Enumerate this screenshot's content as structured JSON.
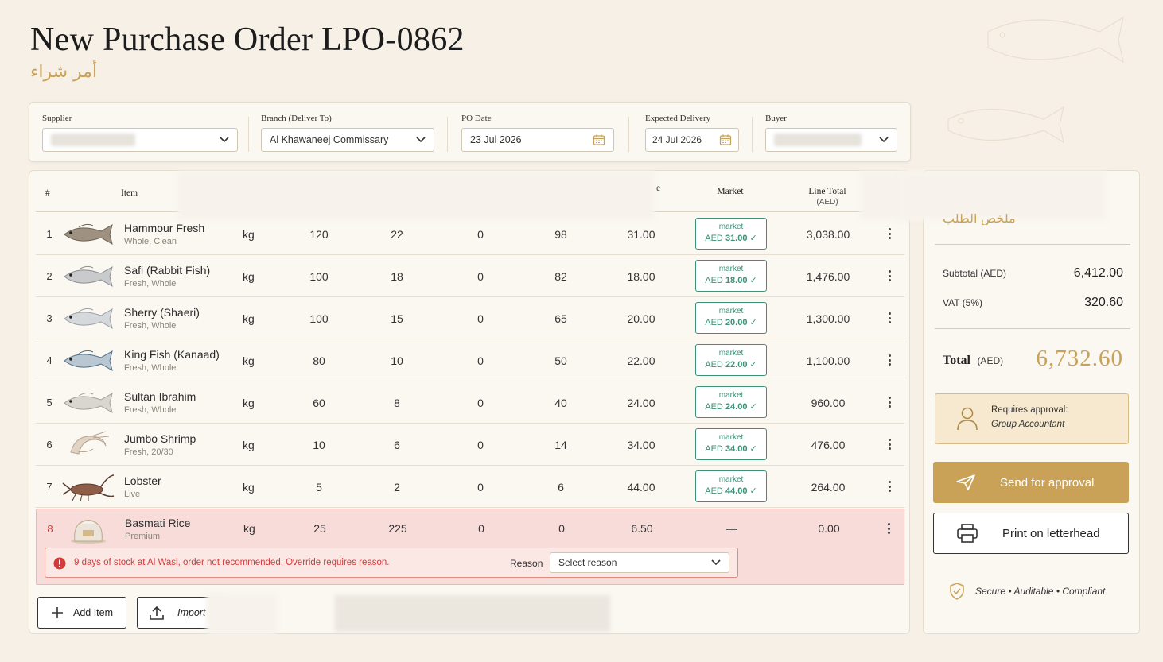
{
  "page": {
    "title": "New Purchase Order LPO-0862",
    "subtitle_ar": "أمر شراء"
  },
  "header": {
    "supplier_label": "Supplier",
    "branch_label": "Branch (Deliver To)",
    "branch_value": "Al Khawaneej Commissary",
    "po_date_label": "PO Date",
    "po_date_value": "23 Jul 2026",
    "expected_label": "Expected Delivery",
    "expected_value": "24 Jul 2026",
    "buyer_label": "Buyer"
  },
  "table": {
    "headers": {
      "hash": "#",
      "item": "Item",
      "partial": "e",
      "market": "Market",
      "line_total": "Line Total",
      "line_total_unit": "(AED)"
    },
    "rows": [
      {
        "n": "1",
        "name": "Hammour Fresh",
        "sub": "Whole, Clean",
        "unit": "kg",
        "c1": "120",
        "c2": "22",
        "c3": "0",
        "c4": "98",
        "price": "31.00",
        "m1": "market",
        "m2": "AED ",
        "m2b": "31.00",
        "check": "✓",
        "total": "3,038.00"
      },
      {
        "n": "2",
        "name": "Safi (Rabbit Fish)",
        "sub": "Fresh, Whole",
        "unit": "kg",
        "c1": "100",
        "c2": "18",
        "c3": "0",
        "c4": "82",
        "price": "18.00",
        "m1": "market",
        "m2": "AED ",
        "m2b": "18.00",
        "check": "✓",
        "total": "1,476.00"
      },
      {
        "n": "3",
        "name": "Sherry (Shaeri)",
        "sub": "Fresh, Whole",
        "unit": "kg",
        "c1": "100",
        "c2": "15",
        "c3": "0",
        "c4": "65",
        "price": "20.00",
        "m1": "market",
        "m2": "AED ",
        "m2b": "20.00",
        "check": "✓",
        "total": "1,300.00"
      },
      {
        "n": "4",
        "name": "King Fish (Kanaad)",
        "sub": "Fresh, Whole",
        "unit": "kg",
        "c1": "80",
        "c2": "10",
        "c3": "0",
        "c4": "50",
        "price": "22.00",
        "m1": "market",
        "m2": "AED ",
        "m2b": "22.00",
        "check": "✓",
        "total": "1,100.00"
      },
      {
        "n": "5",
        "name": "Sultan Ibrahim",
        "sub": "Fresh, Whole",
        "unit": "kg",
        "c1": "60",
        "c2": "8",
        "c3": "0",
        "c4": "40",
        "price": "24.00",
        "m1": "market",
        "m2": "AED ",
        "m2b": "24.00",
        "check": "✓",
        "total": "960.00"
      },
      {
        "n": "6",
        "name": "Jumbo Shrimp",
        "sub": "Fresh, 20/30",
        "unit": "kg",
        "c1": "10",
        "c2": "6",
        "c3": "0",
        "c4": "14",
        "price": "34.00",
        "m1": "market",
        "m2": "AED ",
        "m2b": "34.00",
        "check": "✓",
        "total": "476.00"
      },
      {
        "n": "7",
        "name": "Lobster",
        "sub": "Live",
        "unit": "kg",
        "c1": "5",
        "c2": "2",
        "c3": "0",
        "c4": "6",
        "price": "44.00",
        "m1": "market",
        "m2": "AED ",
        "m2b": "44.00",
        "check": "✓",
        "total": "264.00"
      }
    ],
    "warn_row": {
      "n": "8",
      "name": "Basmati Rice",
      "sub": "Premium",
      "unit": "kg",
      "c1": "25",
      "c2": "225",
      "c3": "0",
      "c4": "0",
      "price": "6.50",
      "market": "—",
      "total": "0.00"
    },
    "warning": {
      "message": "9 days of stock at Al Wasl, order not recommended. Override requires reason.",
      "reason_label": "Reason",
      "reason_placeholder": "Select reason"
    }
  },
  "footer": {
    "add_item": "Add Item",
    "import": "Import"
  },
  "summary": {
    "heading_ar": "ملخص الطلب",
    "subtotal_label": "Subtotal (AED)",
    "subtotal_value": "6,412.00",
    "vat_label": "VAT (5%)",
    "vat_value": "320.60",
    "total_label": "Total",
    "total_unit": "(AED)",
    "total_value": "6,732.60",
    "approval_title": "Requires approval:",
    "approval_role": "Group Accountant",
    "send_button": "Send for approval",
    "print_button": "Print on letterhead",
    "secure_text": "Secure • Auditable • Compliant"
  },
  "colors": {
    "gold": "#c9a257",
    "market_green": "#3e8f77",
    "warning_red": "#d33b3b",
    "warning_bg": "#f8dcd9"
  }
}
